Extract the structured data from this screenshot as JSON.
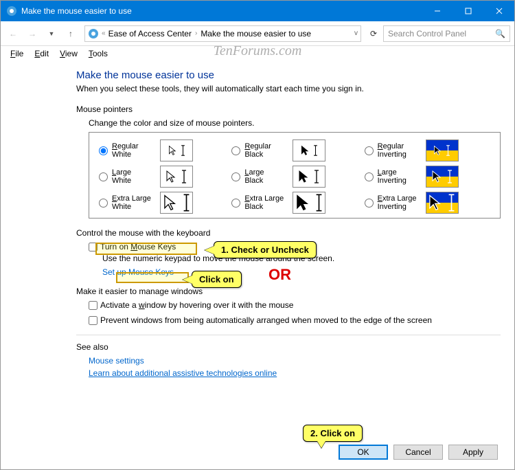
{
  "window": {
    "title": "Make the mouse easier to use"
  },
  "breadcrumb": {
    "a": "Ease of Access Center",
    "b": "Make the mouse easier to use"
  },
  "search": {
    "placeholder": "Search Control Panel"
  },
  "menu": {
    "file": "File",
    "edit": "Edit",
    "view": "View",
    "tools": "Tools"
  },
  "page": {
    "heading": "Make the mouse easier to use",
    "sub": "When you select these tools, they will automatically start each time you sign in."
  },
  "pointers": {
    "label": "Mouse pointers",
    "desc": "Change the color and size of mouse pointers.",
    "items": [
      "Regular White",
      "Regular Black",
      "Regular Inverting",
      "Large White",
      "Large Black",
      "Large Inverting",
      "Extra Large White",
      "Extra Large Black",
      "Extra Large Inverting"
    ]
  },
  "keyboard": {
    "label": "Control the mouse with the keyboard",
    "chk": "Turn on Mouse Keys",
    "help": "Use the numeric keypad to move the mouse around the screen.",
    "link": "Set up Mouse Keys"
  },
  "windows": {
    "label": "Make it easier to manage windows",
    "c1": "Activate a window by hovering over it with the mouse",
    "c2": "Prevent windows from being automatically arranged when moved to the edge of the screen"
  },
  "seealso": {
    "label": "See also",
    "l1": "Mouse settings",
    "l2": "Learn about additional assistive technologies online"
  },
  "buttons": {
    "ok": "OK",
    "cancel": "Cancel",
    "apply": "Apply"
  },
  "annot": {
    "c1": "1. Check or Uncheck",
    "c2": "Click on",
    "c3": "2. Click on",
    "or": "OR"
  },
  "watermark": "TenForums.com"
}
